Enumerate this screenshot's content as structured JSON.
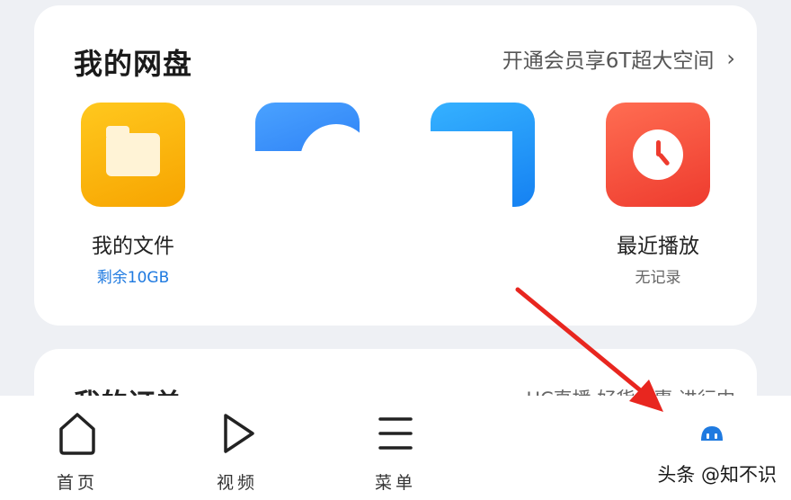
{
  "disk_card": {
    "title": "我的网盘",
    "promo": "开通会员享6T超大空间",
    "tiles": [
      {
        "label": "我的文件",
        "sub": "剩余10GB",
        "sub_color": "#1f7ae0",
        "icon": "folder-icon"
      },
      {
        "label": "",
        "sub": "",
        "icon": "blue-app-icon"
      },
      {
        "label": "",
        "sub": "",
        "icon": "blue-app-icon-2"
      },
      {
        "label": "最近播放",
        "sub": "无记录",
        "sub_color": "#666666",
        "icon": "clock-icon"
      }
    ]
  },
  "orders_card": {
    "title": "我的订单",
    "link": "UC直播 好货优惠 进行中"
  },
  "tabbar": {
    "items": [
      {
        "label": "首页",
        "icon": "home-icon"
      },
      {
        "label": "视频",
        "icon": "play-icon"
      },
      {
        "label": "菜单",
        "icon": "menu-icon"
      },
      {
        "label": "",
        "icon": "avatar-icon"
      }
    ]
  },
  "watermark": "头条 @知不识",
  "colors": {
    "background": "#eef0f4",
    "card": "#ffffff",
    "arrow": "#e8261f",
    "accent_blue": "#1f7ae0"
  }
}
